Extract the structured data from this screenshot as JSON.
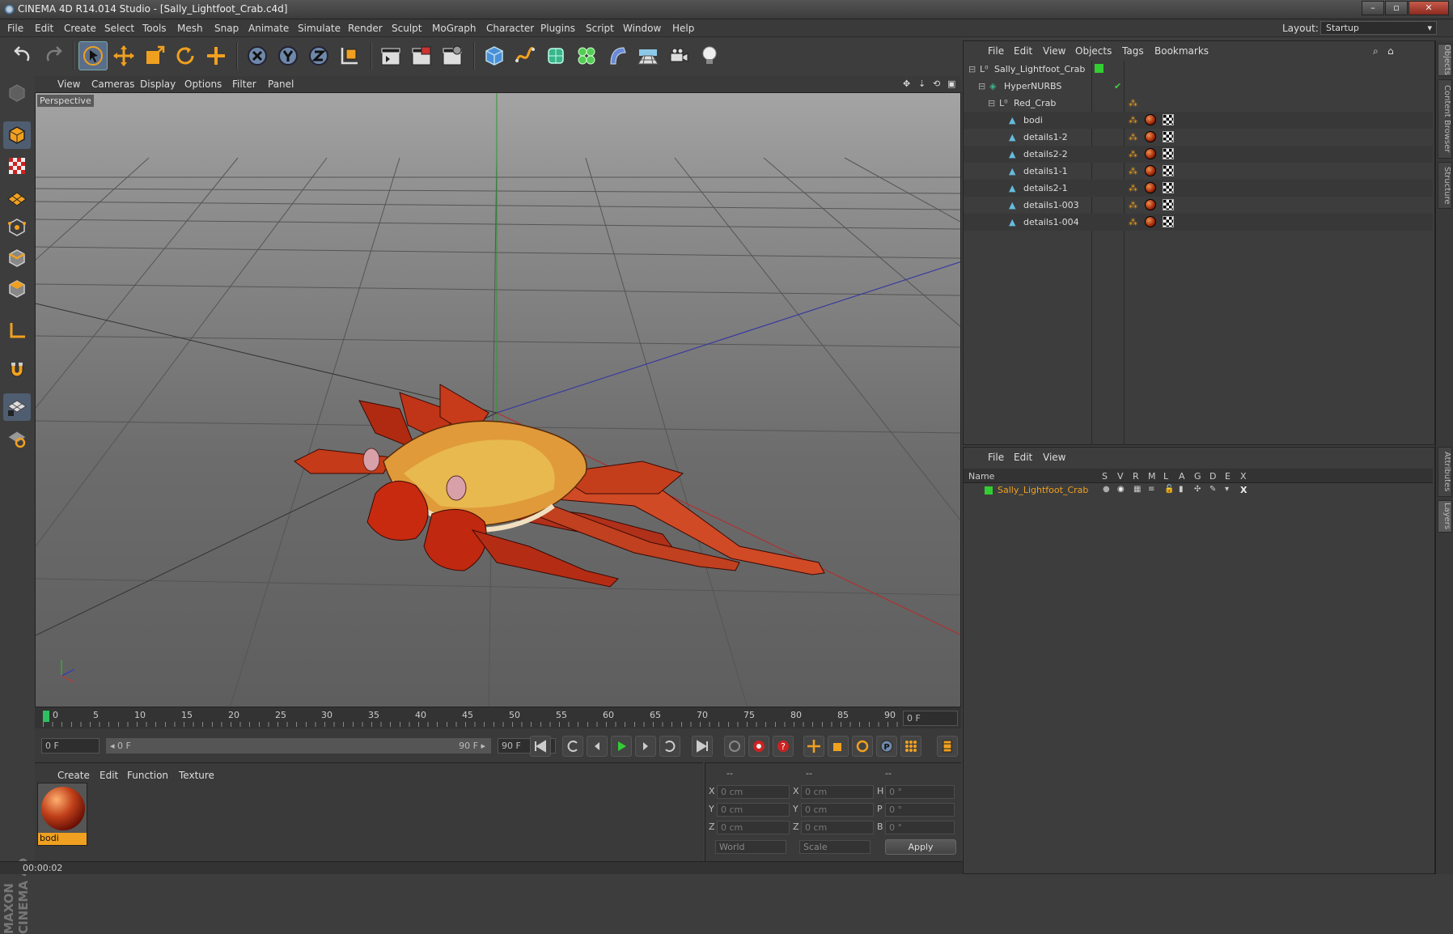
{
  "window": {
    "title": "CINEMA 4D R14.014 Studio - [Sally_Lightfoot_Crab.c4d]",
    "controls": [
      "–",
      "▫",
      "✕"
    ]
  },
  "menu": [
    "File",
    "Edit",
    "Create",
    "Select",
    "Tools",
    "Mesh",
    "Snap",
    "Animate",
    "Simulate",
    "Render",
    "Sculpt",
    "MoGraph",
    "Character",
    "Plugins",
    "Script",
    "Window",
    "Help"
  ],
  "layout": {
    "label": "Layout:",
    "value": "Startup"
  },
  "viewport": {
    "menu": [
      "View",
      "Cameras",
      "Display",
      "Options",
      "Filter",
      "Panel"
    ],
    "label": "Perspective"
  },
  "timeline": {
    "ticks": [
      "0",
      "5",
      "10",
      "15",
      "20",
      "25",
      "30",
      "35",
      "40",
      "45",
      "50",
      "55",
      "60",
      "65",
      "70",
      "75",
      "80",
      "85",
      "90"
    ],
    "current_frame": "0 F"
  },
  "transport": {
    "start_field": "0 F",
    "range_start": "◂ 0 F",
    "range_end": "90 F ▸",
    "end_field": "90 F"
  },
  "material_panel": {
    "menu": [
      "Create",
      "Edit",
      "Function",
      "Texture"
    ],
    "materials": [
      {
        "name": "bodi"
      }
    ]
  },
  "coords": {
    "headers": [
      "--",
      "--",
      "--"
    ],
    "rows": [
      {
        "a": "X",
        "a_val": "0 cm",
        "b": "X",
        "b_val": "0 cm",
        "c": "H",
        "c_val": "0 °"
      },
      {
        "a": "Y",
        "a_val": "0 cm",
        "b": "Y",
        "b_val": "0 cm",
        "c": "P",
        "c_val": "0 °"
      },
      {
        "a": "Z",
        "a_val": "0 cm",
        "b": "Z",
        "b_val": "0 cm",
        "c": "B",
        "c_val": "0 °"
      }
    ],
    "world": "World",
    "scale": "Scale",
    "apply": "Apply"
  },
  "status": {
    "time": "00:00:02"
  },
  "object_manager": {
    "menu": [
      "File",
      "Edit",
      "View",
      "Objects",
      "Tags",
      "Bookmarks"
    ],
    "objects": [
      {
        "name": "Sally_Lightfoot_Crab",
        "depth": 0,
        "type": "null"
      },
      {
        "name": "HyperNURBS",
        "depth": 1,
        "type": "nurbs"
      },
      {
        "name": "Red_Crab",
        "depth": 2,
        "type": "null"
      },
      {
        "name": "bodi",
        "depth": 3,
        "type": "poly"
      },
      {
        "name": "details1-2",
        "depth": 3,
        "type": "poly"
      },
      {
        "name": "details2-2",
        "depth": 3,
        "type": "poly"
      },
      {
        "name": "details1-1",
        "depth": 3,
        "type": "poly"
      },
      {
        "name": "details2-1",
        "depth": 3,
        "type": "poly"
      },
      {
        "name": "details1-003",
        "depth": 3,
        "type": "poly"
      },
      {
        "name": "details1-004",
        "depth": 3,
        "type": "poly"
      }
    ]
  },
  "layer_manager": {
    "menu": [
      "File",
      "Edit",
      "View"
    ],
    "columns": {
      "name": "Name",
      "flags": [
        "S",
        "V",
        "R",
        "M",
        "L",
        "A",
        "G",
        "D",
        "E",
        "X"
      ]
    },
    "layers": [
      {
        "name": "Sally_Lightfoot_Crab",
        "color": "#33cc33"
      }
    ]
  },
  "side_tabs": [
    "Objects",
    "Content Browser",
    "Structure",
    "Attributes",
    "Layers"
  ],
  "colors": {
    "accent": "#f0a020",
    "selection": "#5a6e89",
    "layer_green": "#33cc33"
  }
}
